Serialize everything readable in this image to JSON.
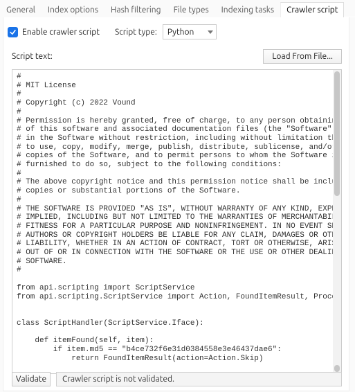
{
  "tabs": {
    "general": "General",
    "index_options": "Index options",
    "hash_filtering": "Hash filtering",
    "file_types": "File types",
    "indexing_tasks": "Indexing tasks",
    "crawler_script": "Crawler script"
  },
  "row1": {
    "enable_label": "Enable crawler script",
    "type_label": "Script type:",
    "type_value": "Python"
  },
  "row2": {
    "script_text_label": "Script text:",
    "load_button": "Load From File..."
  },
  "code": "#\n# MIT License\n#\n# Copyright (c) 2022 Vound\n#\n# Permission is hereby granted, free of charge, to any person obtaining a copy\n# of this software and associated documentation files (the \"Software\"), to deal\n# in the Software without restriction, including without limitation the rights\n# to use, copy, modify, merge, publish, distribute, sublicense, and/or sell\n# copies of the Software, and to permit persons to whom the Software is\n# furnished to do so, subject to the following conditions:\n#\n# The above copyright notice and this permission notice shall be included in all\n# copies or substantial portions of the Software.\n#\n# THE SOFTWARE IS PROVIDED \"AS IS\", WITHOUT WARRANTY OF ANY KIND, EXPRESS OR\n# IMPLIED, INCLUDING BUT NOT LIMITED TO THE WARRANTIES OF MERCHANTABILITY,\n# FITNESS FOR A PARTICULAR PURPOSE AND NONINFRINGEMENT. IN NO EVENT SHALL THE\n# AUTHORS OR COPYRIGHT HOLDERS BE LIABLE FOR ANY CLAIM, DAMAGES OR OTHER\n# LIABILITY, WHETHER IN AN ACTION OF CONTRACT, TORT OR OTHERWISE, ARISING FROM,\n# OUT OF OR IN CONNECTION WITH THE SOFTWARE OR THE USE OR OTHER DEALINGS IN THE\n# SOFTWARE.\n#\n\nfrom api.scripting import ScriptService\nfrom api.scripting.ScriptService import Action, FoundItemResult, ProcessedItemResult\n\n\nclass ScriptHandler(ScriptService.Iface):\n\n    def itemFound(self, item):\n        if item.md5 == \"b4ce732f6e31d0384558e3e46437dae6\":\n            return FoundItemResult(action=Action.Skip)\n\n        return FoundItemResult(action=Action.Include)",
  "row3": {
    "validate_button": "Validate",
    "status_text": "Crawler script is not validated."
  }
}
